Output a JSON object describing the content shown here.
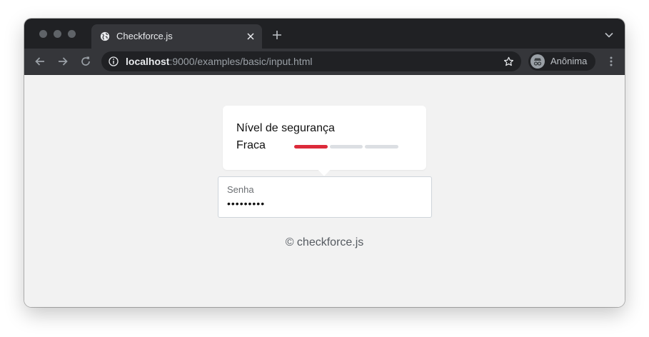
{
  "browser": {
    "tab": {
      "title": "Checkforce.js",
      "favicon": "globe-icon"
    },
    "address_bar": {
      "host": "localhost",
      "path": ":9000/examples/basic/input.html"
    },
    "profile": {
      "label": "Anônima",
      "icon": "incognito-icon"
    },
    "colors": {
      "frame": "#202124",
      "toolbar": "#35363a"
    }
  },
  "page": {
    "strength_popover": {
      "title": "Nível de segurança",
      "level_label": "Fraca",
      "meter": {
        "segments": 3,
        "active_segments": 1,
        "active_color": "#dc2a3a",
        "inactive_color": "#dcdfe3"
      }
    },
    "password_field": {
      "label": "Senha",
      "masked_value": "•••••••••"
    },
    "footer": {
      "text": "© checkforce.js"
    }
  }
}
